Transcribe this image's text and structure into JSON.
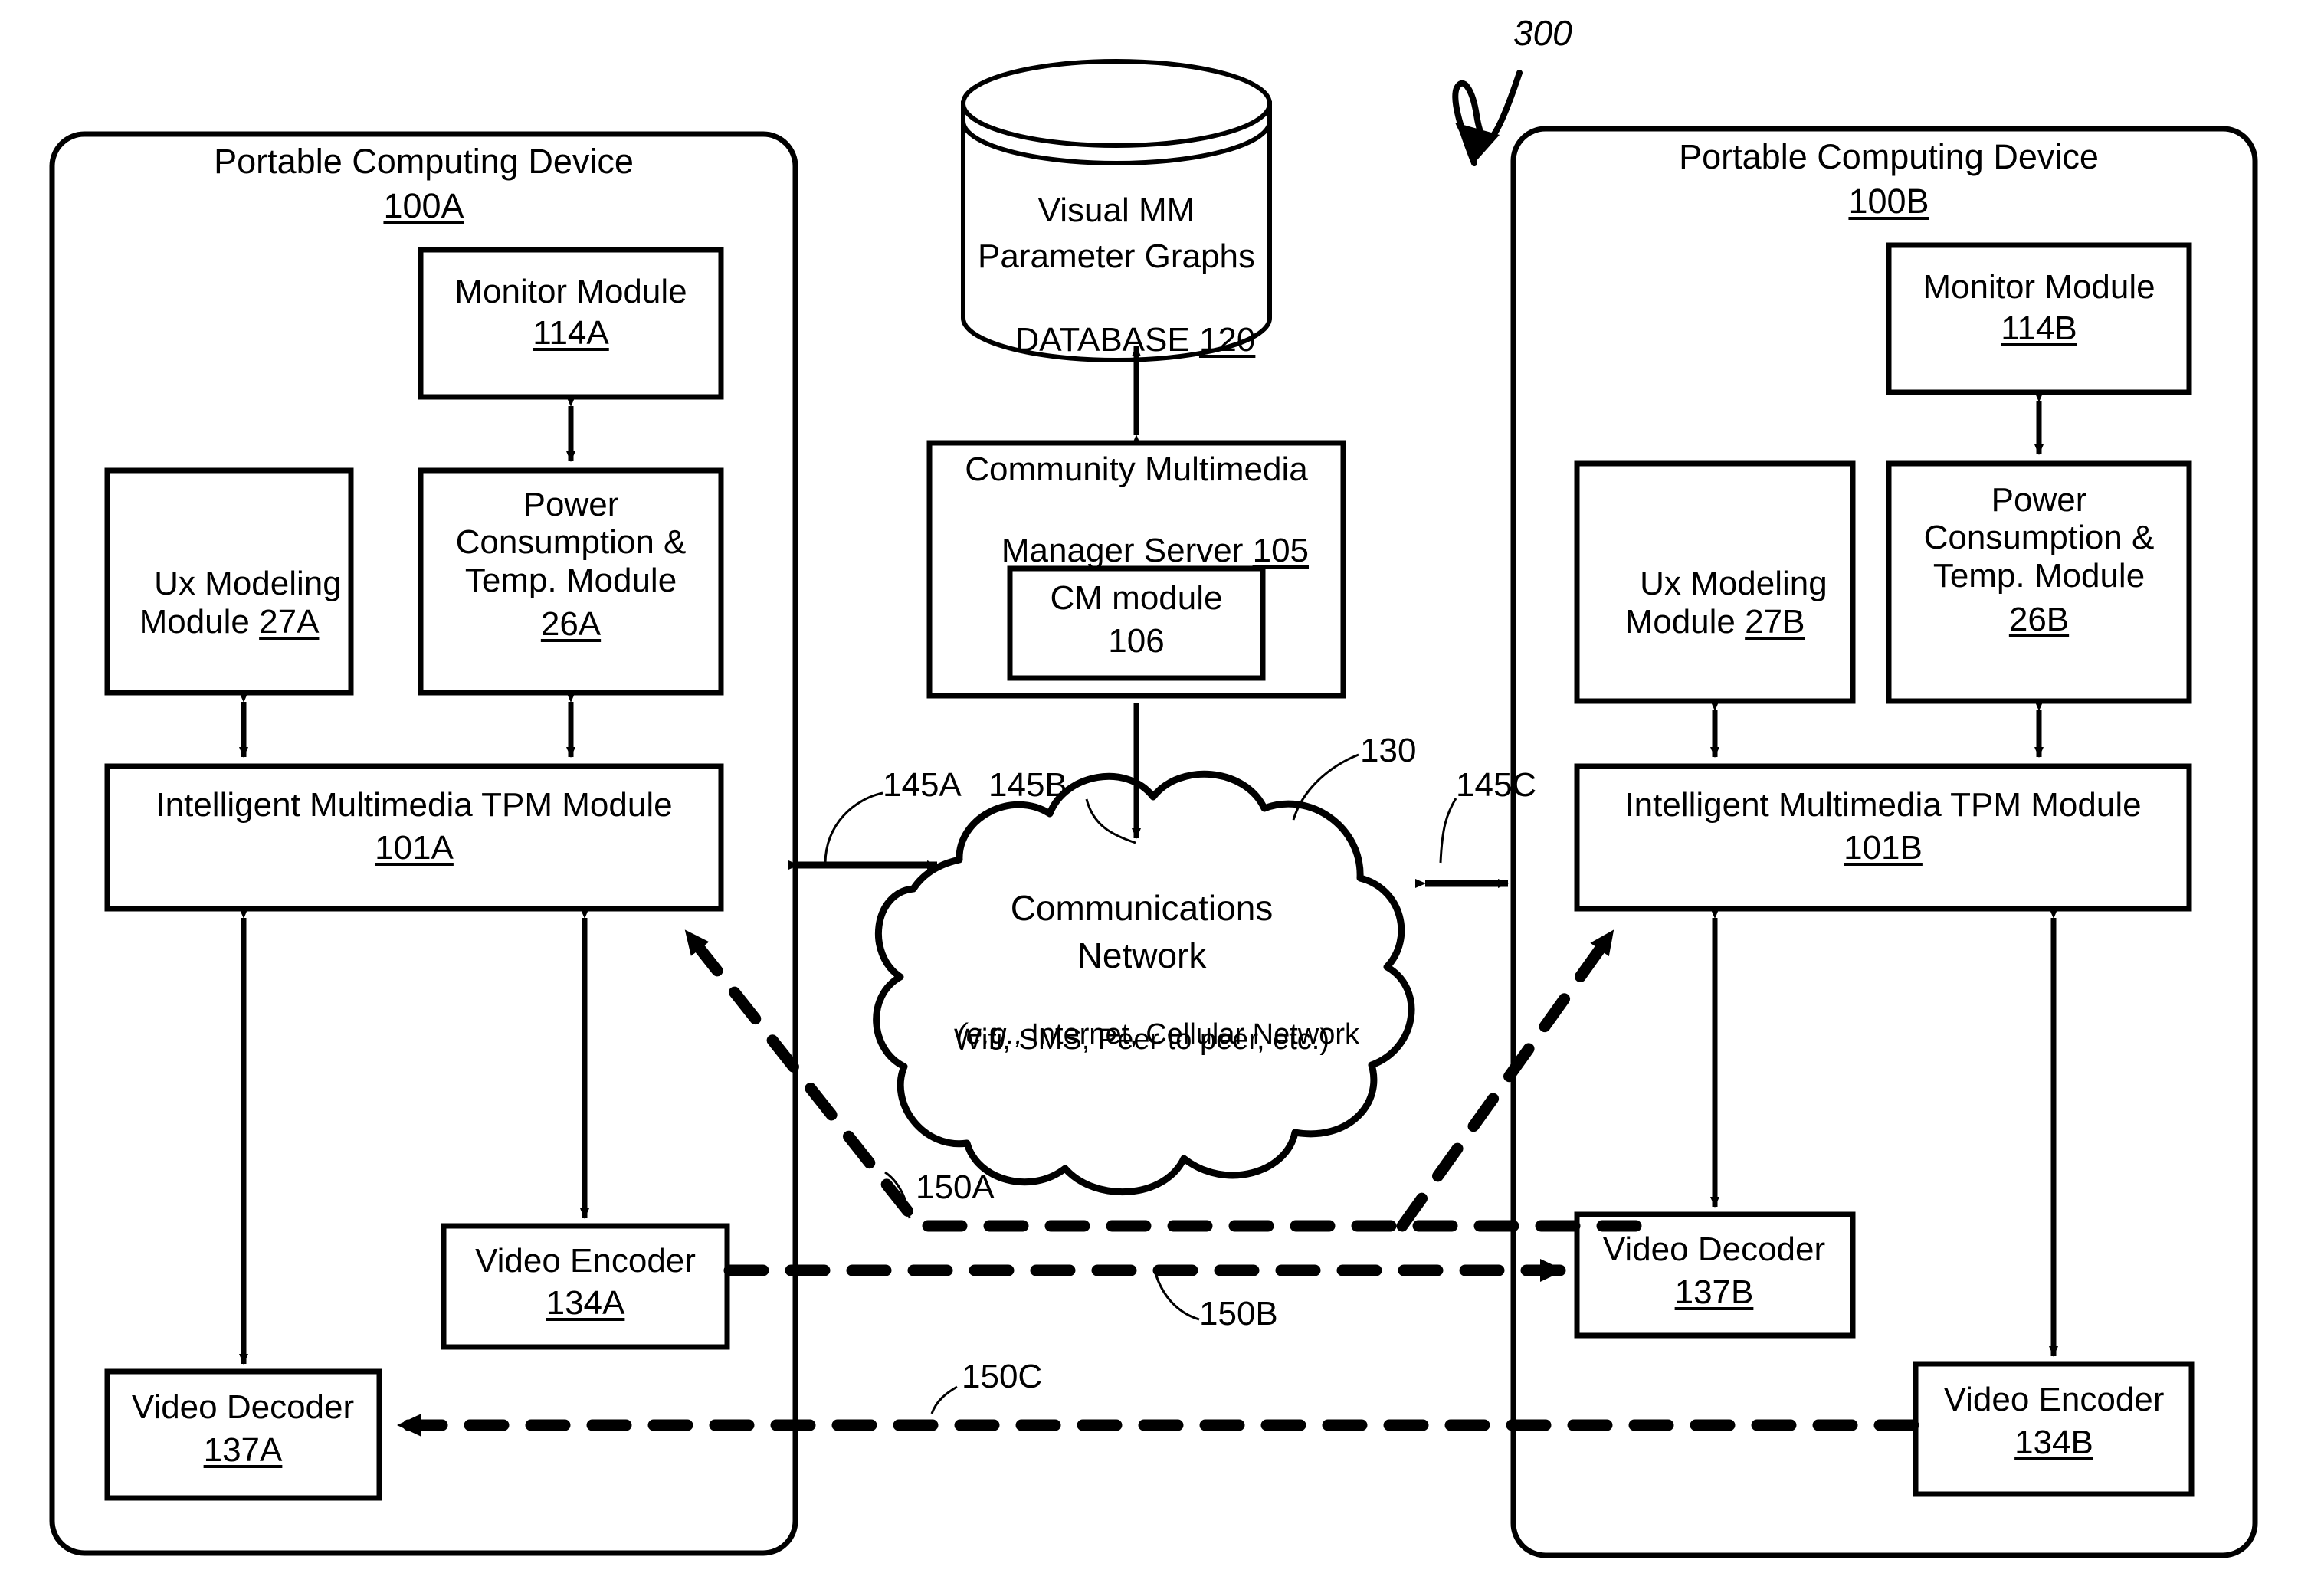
{
  "figure": {
    "number": "300"
  },
  "devices": [
    {
      "id": "device-a",
      "title": "Portable Computing Device",
      "ref": "100A",
      "monitor_module": {
        "label": "Monitor Module",
        "ref": "114A"
      },
      "ux_module": {
        "label": "Ux Modeling\nModule ",
        "ref": "27A"
      },
      "power_module": {
        "label": "Power\nConsumption &\nTemp. Module",
        "ref": "26A"
      },
      "tpm_module": {
        "label": "Intelligent Multimedia TPM Module",
        "ref": "101A"
      },
      "video_encoder": {
        "label": "Video Encoder",
        "ref": "134A"
      },
      "video_decoder": {
        "label": "Video Decoder",
        "ref": "137A"
      }
    },
    {
      "id": "device-b",
      "title": "Portable Computing Device",
      "ref": "100B",
      "monitor_module": {
        "label": "Monitor Module",
        "ref": "114B"
      },
      "ux_module": {
        "label": "Ux Modeling\nModule ",
        "ref": "27B"
      },
      "power_module": {
        "label": "Power\nConsumption &\nTemp. Module",
        "ref": "26B"
      },
      "tpm_module": {
        "label": "Intelligent Multimedia TPM Module",
        "ref": "101B"
      },
      "video_encoder": {
        "label": "Video Encoder",
        "ref": "134B"
      },
      "video_decoder": {
        "label": "Video Decoder",
        "ref": "137B"
      }
    }
  ],
  "database": {
    "line1": "Visual MM",
    "line2": "Parameter Graphs",
    "line3": "DATABASE ",
    "ref": "120"
  },
  "server": {
    "line1": "Community Multimedia",
    "line2": "Manager Server ",
    "ref": "105",
    "cm_module": {
      "label": "CM module",
      "ref": "106"
    }
  },
  "network": {
    "line1": "Communications",
    "line2": "Network",
    "line3": "(e.g.,",
    "line3b": " Internet, Cellular Network",
    "line4": "Wifi, SMS, Peer to peer, etc.)",
    "ref": "130"
  },
  "connector_labels": {
    "link_145a": "145A",
    "link_145b": "145B",
    "link_145c": "145C",
    "link_150a": "150A",
    "link_150b": "150B",
    "link_150c": "150C"
  }
}
